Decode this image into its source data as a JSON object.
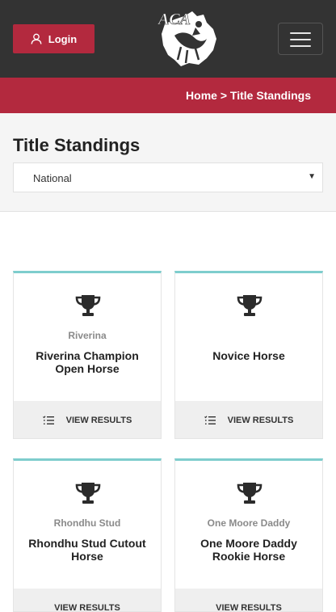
{
  "header": {
    "login_label": "Login",
    "logo_text": "ACA",
    "colors": {
      "topbar": "#333333",
      "accent": "#b3293e",
      "card_border": "#7ecdcd"
    }
  },
  "breadcrumb": {
    "home": "Home",
    "separator": ">",
    "current": "Title Standings"
  },
  "page": {
    "title": "Title Standings",
    "filter_value": "National"
  },
  "cards": [
    {
      "subtitle": "Riverina",
      "title": "Riverina Champion Open Horse",
      "action": "VIEW RESULTS",
      "icon": "trophy-icon"
    },
    {
      "subtitle": "",
      "title": "Novice Horse",
      "action": "VIEW RESULTS",
      "icon": "trophy-icon"
    },
    {
      "subtitle": "Rhondhu Stud",
      "title": "Rhondhu Stud Cutout Horse",
      "action": "VIEW RESULTS",
      "icon": "trophy-icon"
    },
    {
      "subtitle": "One Moore Daddy",
      "title": "One Moore Daddy Rookie Horse",
      "action": "VIEW RESULTS",
      "icon": "trophy-icon"
    }
  ]
}
